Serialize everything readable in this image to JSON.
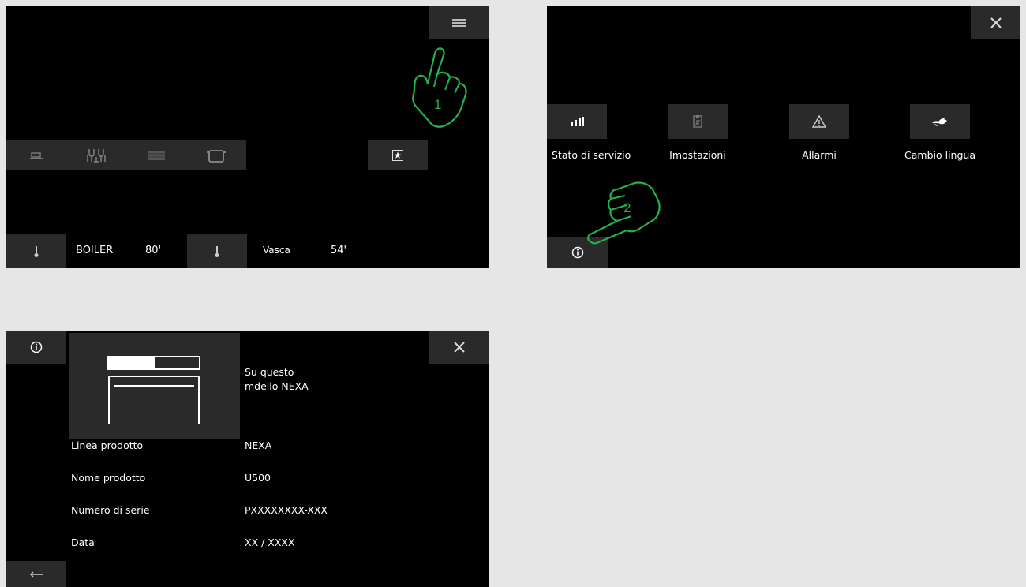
{
  "screen1": {
    "icons": [
      "menu-icon",
      "cup-icon",
      "glasses-icon",
      "tray-icon",
      "pot-icon",
      "favorite-star-icon",
      "thermometer-icon"
    ],
    "boiler_label": "BOILER",
    "boiler_temp": "80'",
    "tank_label": "Vasca",
    "tank_temp": "54'"
  },
  "screen2": {
    "tiles": [
      {
        "label": "Stato di servizio",
        "icon": "signal-bars-icon"
      },
      {
        "label": "Imostazioni",
        "icon": "settings-icon"
      },
      {
        "label": "Allarmi",
        "icon": "warning-icon"
      },
      {
        "label": "Cambio lingua",
        "icon": "language-icon"
      }
    ]
  },
  "screen3": {
    "about_line1": "Su questo",
    "about_line2": "mdello NEXA",
    "rows": [
      {
        "label": "Linea prodotto",
        "value": "NEXA"
      },
      {
        "label": "Nome prodotto",
        "value": "U500"
      },
      {
        "label": "Numero di serie",
        "value": "PXXXXXXXX-XXX"
      },
      {
        "label": "Data",
        "value": "XX / XXXX"
      }
    ]
  },
  "steps": {
    "step1": "1",
    "step2": "2"
  },
  "colors": {
    "screen_bg": "#000000",
    "button_bg": "#2a2a2a",
    "page_bg": "#e6e6e6",
    "annotation": "#22b14c"
  }
}
